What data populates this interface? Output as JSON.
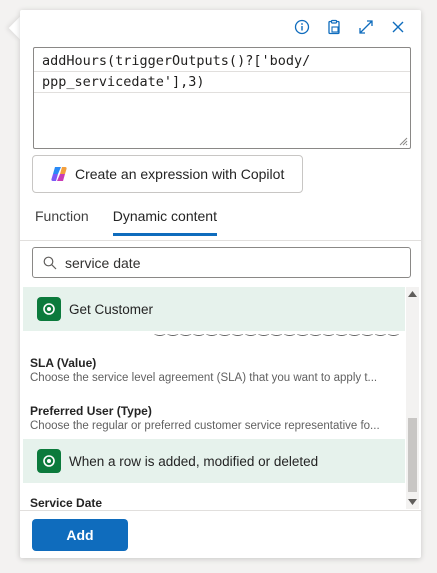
{
  "expression": {
    "line1": "addHours(triggerOutputs()?['body/",
    "line2": "ppp_servicedate'],3)"
  },
  "copilot": {
    "label": "Create an expression with Copilot"
  },
  "tabs": [
    {
      "label": "Function",
      "active": false
    },
    {
      "label": "Dynamic content",
      "active": true
    }
  ],
  "search": {
    "value": "service date"
  },
  "list": {
    "groups": [
      {
        "label": "Get Customer",
        "icon": "dataverse-icon"
      },
      {
        "label": "When a row is added, modified or deleted",
        "icon": "dataverse-icon"
      }
    ],
    "items": [
      {
        "title": "SLA (Value)",
        "description": "Choose the service level agreement (SLA) that you want to apply t..."
      },
      {
        "title": "Preferred User (Type)",
        "description": "Choose the regular or preferred customer service representative fo..."
      },
      {
        "title": "Service Date",
        "description": ""
      }
    ]
  },
  "footer": {
    "add_label": "Add"
  },
  "colors": {
    "accent": "#0f6cbd",
    "group_bg": "#e6f2ec",
    "dataverse": "#0b7a3c"
  }
}
